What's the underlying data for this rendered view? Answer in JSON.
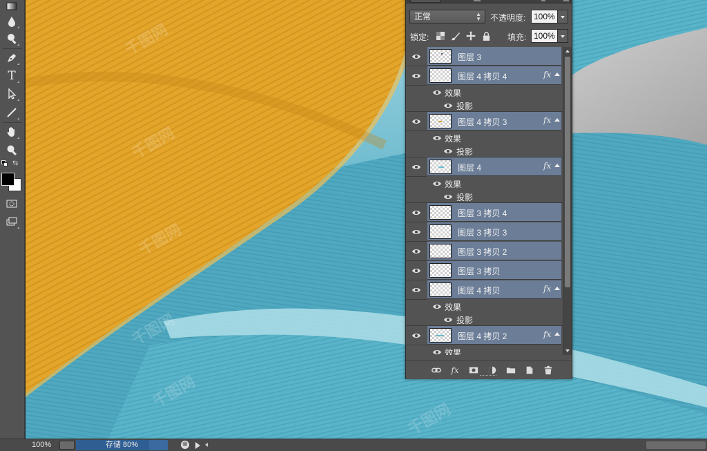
{
  "toolbar": {
    "tools": [
      "gradient-tool",
      "blur-tool",
      "dodge-tool",
      "pen-tool",
      "type-tool",
      "path-selection-tool",
      "line-tool",
      "hand-tool",
      "zoom-tool",
      "default-colors",
      "swap-colors",
      "foreground-color",
      "background-color",
      "quick-mask",
      "screen-mode"
    ],
    "foreground": "#000000",
    "background": "#ffffff",
    "type_glyph": "T"
  },
  "canvas": {
    "feather_yellow": "#e0a426",
    "feather_blue": "#5ab3c9",
    "backdrop": "#bfbfbf",
    "watermark": "千图网"
  },
  "status": {
    "zoom": "100%",
    "save_text": "存储 80%",
    "save_progress": 0.8,
    "cancel_glyph": "⊗"
  },
  "layers_panel": {
    "blend_mode": "正常",
    "opacity_label": "不透明度:",
    "opacity_value": "100%",
    "lock_label": "锁定:",
    "fill_label": "填充:",
    "fill_value": "100%",
    "fx_glyph": "fx",
    "effects_label": "效果",
    "drop_shadow_label": "投影",
    "layers": [
      {
        "name": "图层 3",
        "fx": false
      },
      {
        "name": "图层 4 拷贝 4",
        "fx": true
      },
      {
        "name": "图层 4 拷贝 3",
        "fx": true
      },
      {
        "name": "图层 4",
        "fx": true
      },
      {
        "name": "图层 3 拷贝 4",
        "fx": false
      },
      {
        "name": "图层 3 拷贝 3",
        "fx": false
      },
      {
        "name": "图层 3 拷贝 2",
        "fx": false
      },
      {
        "name": "图层 3 拷贝",
        "fx": false
      },
      {
        "name": "图层 4 拷贝",
        "fx": true
      },
      {
        "name": "图层 4 拷贝 2",
        "fx": true
      }
    ],
    "footer_icons": [
      "link-layers-icon",
      "fx-icon",
      "add-mask-icon",
      "adjustment-layer-icon",
      "new-group-icon",
      "new-layer-icon",
      "delete-layer-icon"
    ]
  }
}
